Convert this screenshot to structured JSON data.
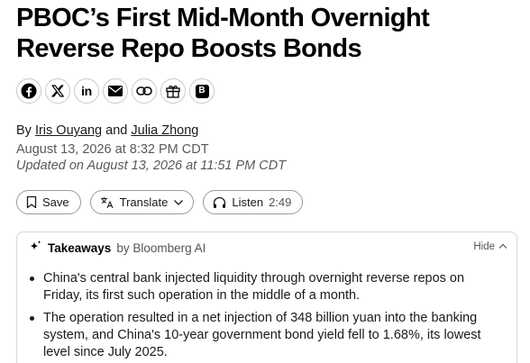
{
  "article": {
    "headline": "PBOC’s First Mid-Month Overnight Reverse Repo Boosts Bonds",
    "byline_prefix": "By",
    "authors": [
      "Iris Ouyang",
      "Julia Zhong"
    ],
    "byline_joiner": "and",
    "published": "August 13, 2026 at 8:32 PM CDT",
    "updated": "Updated on August 13, 2026 at 11:51 PM CDT"
  },
  "share": {
    "icons": [
      "facebook-icon",
      "x-icon",
      "linkedin-icon",
      "email-icon",
      "link-icon",
      "gift-icon",
      "bloomberg-terminal-icon"
    ],
    "linkedin_text": "in",
    "terminal_text": "B"
  },
  "actions": {
    "save_label": "Save",
    "translate_label": "Translate",
    "listen_label": "Listen",
    "listen_duration": "2:49"
  },
  "takeaways": {
    "title": "Takeaways",
    "by_label": "by Bloomberg AI",
    "hide_label": "Hide",
    "items": [
      "China's central bank injected liquidity through overnight reverse repos on Friday, its first such operation in the middle of a month.",
      "The operation resulted in a net injection of 348 billion yuan into the banking system, and China's 10-year government bond yield fell to 1.68%, its lowest level since July 2025."
    ]
  },
  "colors": {
    "text": "#000000",
    "muted": "#595959",
    "border": "#c9c9c9"
  }
}
